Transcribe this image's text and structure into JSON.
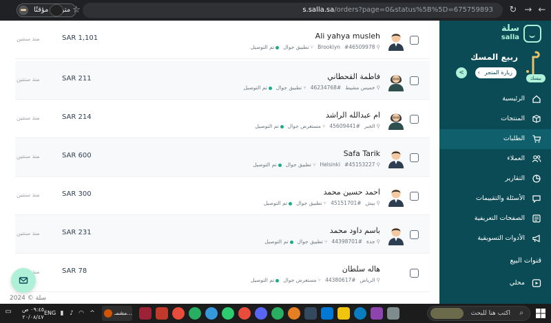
{
  "browser": {
    "url_host": "s.salla.sa",
    "url_path": "/orders?page=0&status%5B%5D=675759893",
    "paused_label": "متوقف مؤقتًا",
    "icons": [
      "back-icon",
      "forward-icon",
      "reload-icon",
      "bookmark-icon"
    ]
  },
  "orders": [
    {
      "name": "Ali yahya musleh",
      "order_no": "#46509978",
      "city": "Brooklyn",
      "source": "تطبيق جوال",
      "status": "تم التوصيل",
      "amount": "SAR 1,101",
      "since": "منذ سنتين",
      "avatar": "male"
    },
    {
      "name": "فاطمة القحطاني",
      "order_no": "#46234768",
      "city": "خميس مشيط",
      "source": "تطبيق جوال",
      "status": "تم التوصيل",
      "amount": "SAR 211",
      "since": "منذ سنتين",
      "avatar": "female"
    },
    {
      "name": "ام عبدالله الراشد",
      "order_no": "#45609441",
      "city": "الخبر",
      "source": "مستعرض جوال",
      "status": "تم التوصيل",
      "amount": "SAR 214",
      "since": "منذ سنتين",
      "avatar": "female"
    },
    {
      "name": "Safa Tarik",
      "order_no": "#45153227",
      "city": "Helsinki",
      "source": "تطبيق جوال",
      "status": "تم التوصيل",
      "amount": "SAR 600",
      "since": "منذ سنتين",
      "avatar": "male"
    },
    {
      "name": "احمد حسين محمد",
      "order_no": "#45151701",
      "city": "بيش",
      "source": "تطبيق جوال",
      "status": "تم التوصيل",
      "amount": "SAR 300",
      "since": "منذ سنتين",
      "avatar": "male"
    },
    {
      "name": "باسم داود محمد",
      "order_no": "#44398701",
      "city": "جدة",
      "source": "تطبيق جوال",
      "status": "تم التوصيل",
      "amount": "SAR 231",
      "since": "منذ سنتين",
      "avatar": "male"
    },
    {
      "name": "هاله سلطان",
      "order_no": "#44380617",
      "city": "الرياض",
      "source": "مستعرض جوال",
      "status": "تم التوصيل",
      "amount": "SAR 78",
      "since": "منذ سنتين",
      "avatar": "none"
    }
  ],
  "footer": {
    "copyright": "سلة © 2024"
  },
  "sidebar": {
    "brand_ar": "سلة",
    "brand_en": "salla",
    "store_name": "ربيع المسك",
    "visit_store": "زيارة المتجر",
    "plan_badge": "بيسك",
    "menu": [
      {
        "label": "الرئيسية",
        "icon": "home-icon",
        "active": false
      },
      {
        "label": "المنتجات",
        "icon": "box-icon",
        "active": false
      },
      {
        "label": "الطلبات",
        "icon": "cart-icon",
        "active": true
      },
      {
        "label": "العملاء",
        "icon": "users-icon",
        "active": false
      },
      {
        "label": "التقارير",
        "icon": "pie-chart-icon",
        "active": false
      },
      {
        "label": "الأسئلة والتقييمات",
        "icon": "chat-icon",
        "active": false
      },
      {
        "label": "الصفحات التعريفية",
        "icon": "page-icon",
        "active": false
      },
      {
        "label": "الأدوات التسويقية",
        "icon": "megaphone-icon",
        "active": false
      }
    ],
    "section_title": "قنوات البيع",
    "local_item": "محلي"
  },
  "taskbar": {
    "search_placeholder": "اكتب هنا للبحث",
    "active_app_label": "مشمـ...",
    "language": "ENG",
    "time": "٠٩:٤٥ ص",
    "date": "٢٠/٠٨/٤٧"
  }
}
